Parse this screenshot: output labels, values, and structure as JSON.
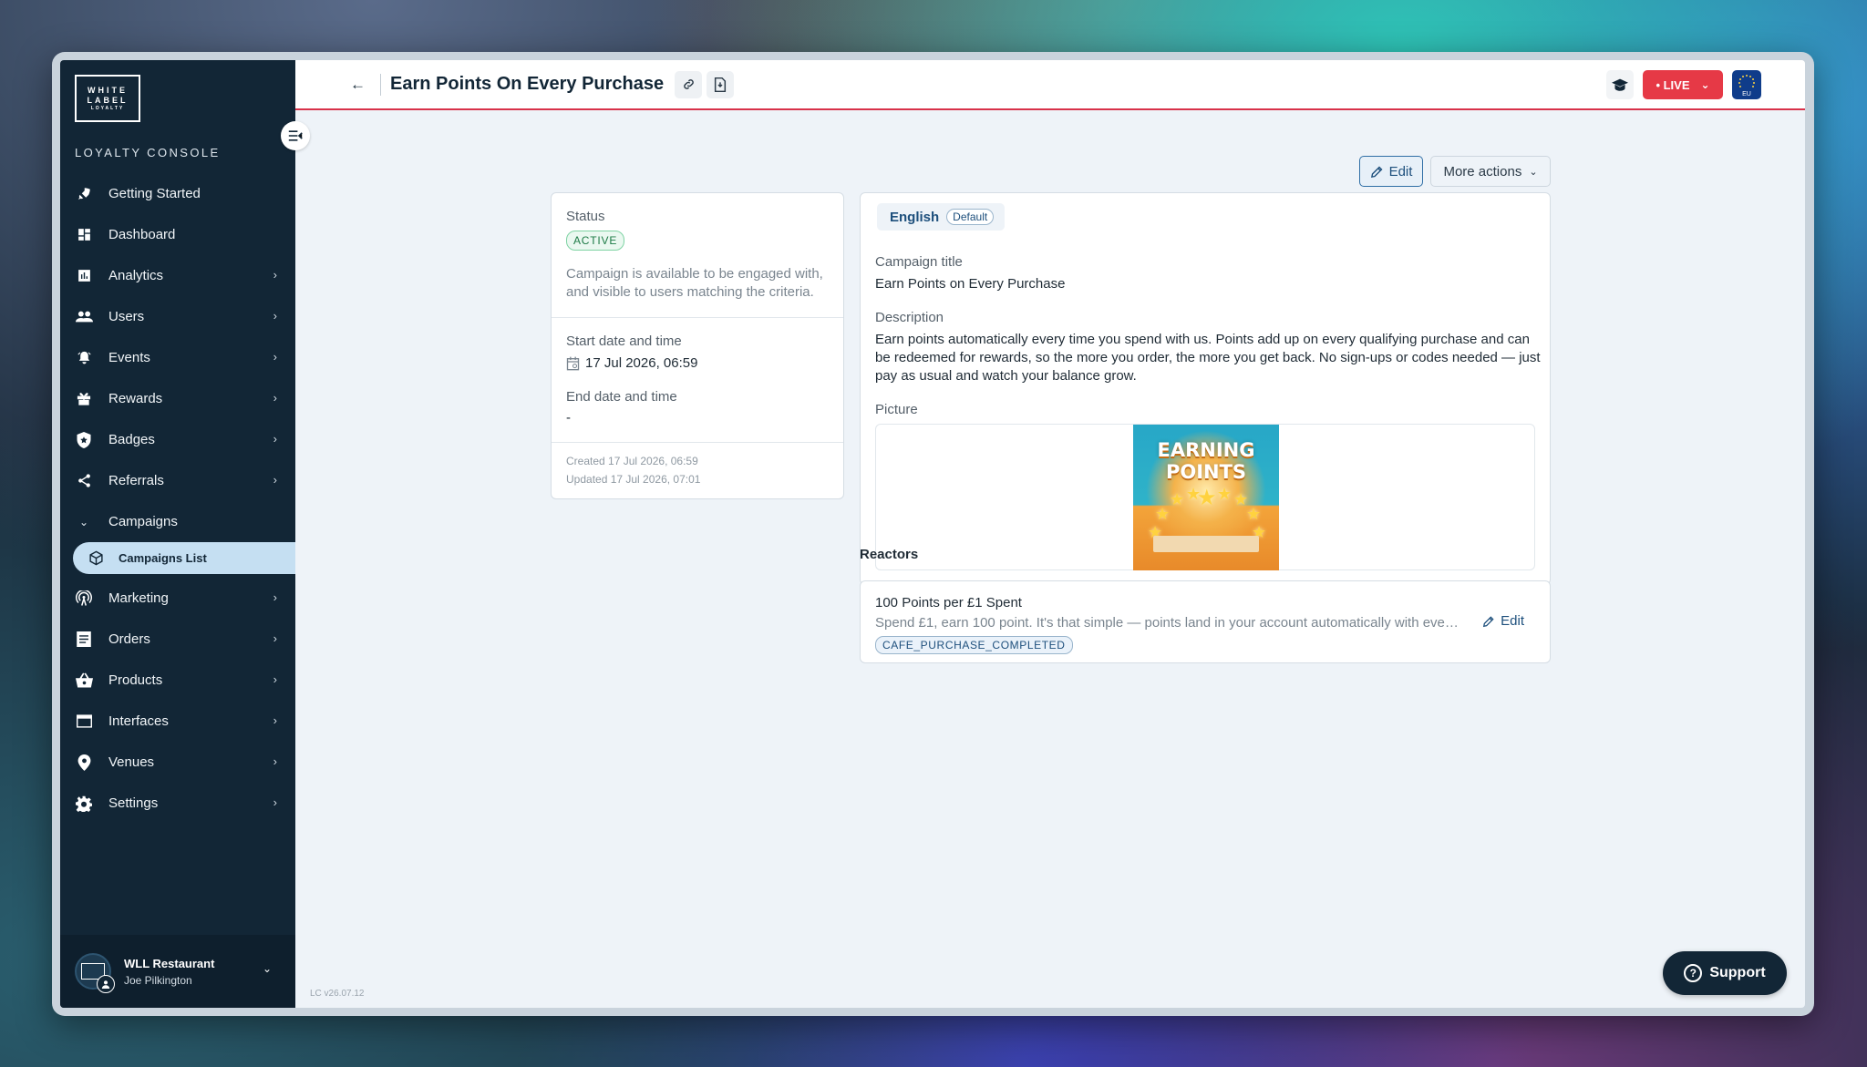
{
  "sidebar": {
    "logo_lines": [
      "WHITE",
      "LABEL",
      "LOYALTY"
    ],
    "console_title": "LOYALTY CONSOLE",
    "items": [
      {
        "label": "Getting Started",
        "icon": "rocket-icon",
        "has_chevron": false
      },
      {
        "label": "Dashboard",
        "icon": "dashboard-icon",
        "has_chevron": false
      },
      {
        "label": "Analytics",
        "icon": "chart-icon",
        "has_chevron": true
      },
      {
        "label": "Users",
        "icon": "users-icon",
        "has_chevron": true
      },
      {
        "label": "Events",
        "icon": "bell-icon",
        "has_chevron": true
      },
      {
        "label": "Rewards",
        "icon": "gift-icon",
        "has_chevron": true
      },
      {
        "label": "Badges",
        "icon": "shield-icon",
        "has_chevron": true
      },
      {
        "label": "Referrals",
        "icon": "share-icon",
        "has_chevron": true
      },
      {
        "label": "Campaigns",
        "icon": "chevron-down-icon",
        "expanded": true
      },
      {
        "label": "Marketing",
        "icon": "broadcast-icon",
        "has_chevron": true
      },
      {
        "label": "Orders",
        "icon": "receipt-icon",
        "has_chevron": true
      },
      {
        "label": "Products",
        "icon": "basket-icon",
        "has_chevron": true
      },
      {
        "label": "Interfaces",
        "icon": "window-icon",
        "has_chevron": true
      },
      {
        "label": "Venues",
        "icon": "pin-icon",
        "has_chevron": true
      },
      {
        "label": "Settings",
        "icon": "gear-icon",
        "has_chevron": true
      }
    ],
    "subitem": {
      "label": "Campaigns List",
      "icon": "cube-icon",
      "active": true
    },
    "account": {
      "name": "WLL Restaurant",
      "user": "Joe Pilkington"
    }
  },
  "header": {
    "title": "Earn Points On Every Purchase",
    "live_label": "• LIVE",
    "region": "EU"
  },
  "actions": {
    "edit_label": "Edit",
    "more_label": "More actions"
  },
  "status_card": {
    "status_label": "Status",
    "status_value": "ACTIVE",
    "status_desc": "Campaign is available to be engaged with, and visible to users matching the criteria.",
    "start_label": "Start date and time",
    "start_value": "17 Jul 2026, 06:59",
    "end_label": "End date and time",
    "end_value": "-",
    "created": "Created 17 Jul 2026, 06:59",
    "updated": "Updated 17 Jul 2026, 07:01"
  },
  "content_card": {
    "language": "English",
    "default_badge": "Default",
    "title_label": "Campaign title",
    "title_value": "Earn Points on Every Purchase",
    "desc_label": "Description",
    "desc_value": "Earn points automatically every time you spend with us. Points add up on every qualifying purchase and can be redeemed for rewards, so the more you order, the more you get back. No sign-ups or codes needed — just pay as usual and watch your balance grow.",
    "picture_label": "Picture",
    "picture_text": [
      "EARNING",
      "POINTS"
    ]
  },
  "reactors": {
    "label": "Reactors",
    "items": [
      {
        "title": "100 Points per £1 Spent",
        "desc": "Spend £1, earn 100 point. It's that simple — points land in your account automatically with ever...",
        "tag": "CAFE_PURCHASE_COMPLETED",
        "edit_label": "Edit"
      }
    ]
  },
  "footer": {
    "version": "LC v26.07.12",
    "support_label": "Support"
  },
  "colors": {
    "sidebar": "#122636",
    "accent": "#1d4f7c",
    "live": "#e63946",
    "active_green": "#1c7a45"
  }
}
